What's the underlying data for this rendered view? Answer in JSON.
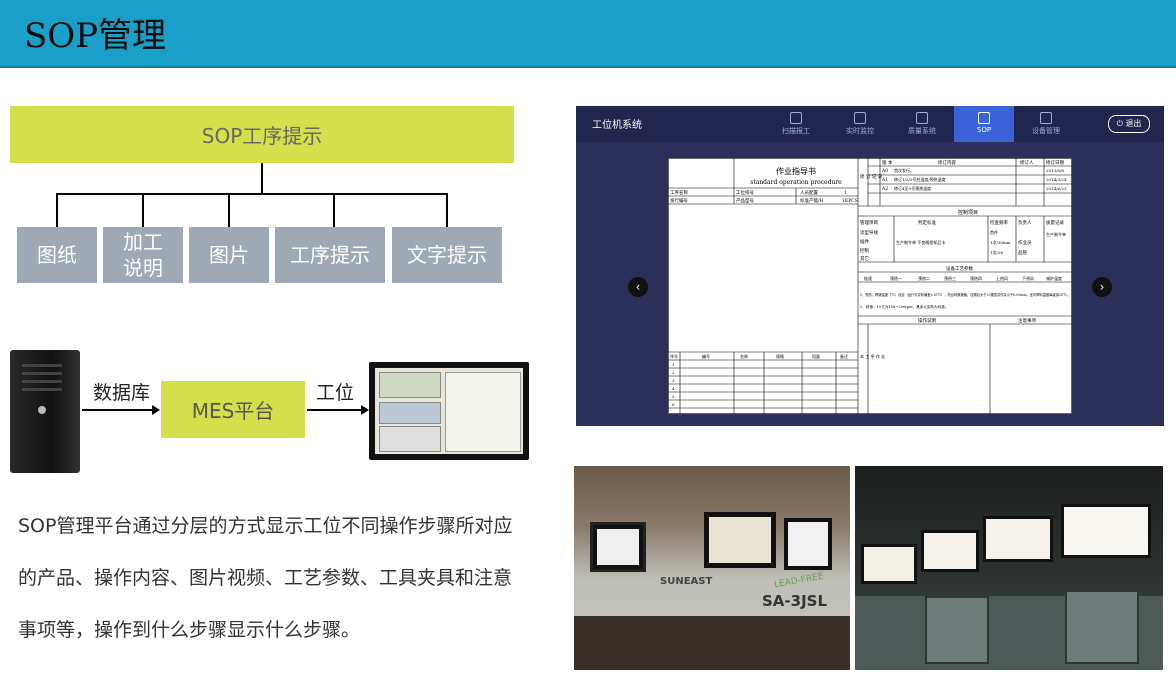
{
  "header": {
    "title": "SOP管理"
  },
  "hierarchy": {
    "top": "SOP工序提示",
    "children": [
      "图纸",
      "加工\n说明",
      "图片",
      "工序提示",
      "文字提示"
    ]
  },
  "flow": {
    "db_label": "数据库",
    "platform": "MES平台",
    "station_label": "工位"
  },
  "description": "SOP管理平台通过分层的方式显示工位不同操作步骤所对应的产品、操作内容、图片视频、工艺参数、工具夹具和注意事项等，操作到什么步骤显示什么步骤。",
  "sop_app": {
    "app_name": "工位机系统",
    "nav": [
      "扫描报工",
      "实时监控",
      "质量系统",
      "SOP",
      "设备管理"
    ],
    "active_nav": "SOP",
    "logout": "退出",
    "prev": "‹",
    "next": "›",
    "document": {
      "title": "作业指导书",
      "subtitle": "standard operation procedure",
      "rev_headers": [
        "版 本",
        "修订内容",
        "修订人",
        "修订日期"
      ],
      "revisions": [
        {
          "ver": "A0",
          "content": "首次发行。",
          "date": "2013/6/8"
        },
        {
          "ver": "A1",
          "content": "修订1/2/3号柱温度/预热温度",
          "date": "2014/3/24"
        },
        {
          "ver": "A2",
          "content": "修订4至9号预热温度",
          "date": "2014/6/23"
        }
      ],
      "rev_side": "修 订 记 录",
      "info_labels": [
        "工序名称",
        "发行编号"
      ],
      "info_mid": [
        "工位排号",
        "产品型号"
      ],
      "info_right": [
        "人员配置",
        "标准产能/H"
      ],
      "info_right_val": [
        "1",
        "1KPCS"
      ],
      "control_title": "控制项目",
      "control_headers": [
        "管理项目",
        "判定标准",
        "检查频率",
        "负责人",
        "质量记录"
      ],
      "control_rows": [
        "流型导线",
        "插件",
        "控制",
        "其它"
      ],
      "control_std": "生产制令单 不良随程样品卡",
      "freq": [
        "首件",
        "1次/30min",
        "1次/2h"
      ],
      "owner": [
        "作业员",
        "品管"
      ],
      "record": "生产制令单",
      "params_title": "设备工艺参数",
      "params_headers": [
        "链速",
        "预热一",
        "预热二",
        "预热三",
        "预热四",
        "上热风",
        "下热风",
        "锡炉温度"
      ],
      "notes": [
        "1、预热、焊锡温度（℃）设定（运行可实际偏差±10℃），机台特殊规格，加锡后大于33规查并作实小于0.05mm，此时焊料温度每级减20℃。",
        "2、转速：10又为150~200rpm，具余以实际为标准。"
      ],
      "steps_headers": [
        "操作说明",
        "注意事项"
      ],
      "bom_headers": [
        "序号",
        "编号",
        "名称",
        "规格",
        "用量",
        "备注"
      ],
      "bom_rows": [
        "1",
        "2",
        "3",
        "4",
        "5",
        "6"
      ],
      "side_note": "本 工 序 作 业"
    }
  },
  "machine_photo": {
    "brand": "SUNEAST",
    "model": "SA-3JSL",
    "badge": "LEAD-FREE"
  }
}
